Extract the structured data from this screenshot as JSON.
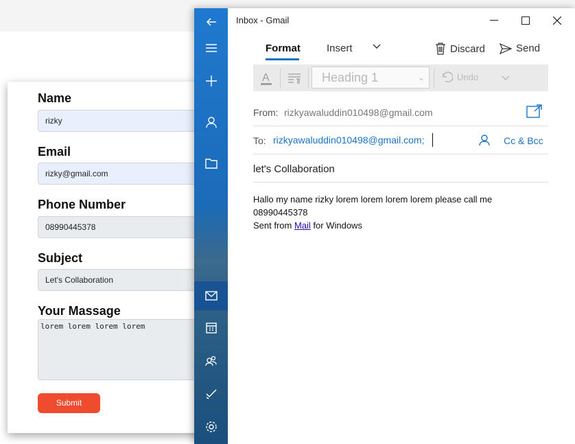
{
  "form": {
    "name_label": "Name",
    "name_value": "rizky",
    "email_label": "Email",
    "email_value": "rizky@gmail.com",
    "phone_label": "Phone Number",
    "phone_value": "08990445378",
    "subject_label": "Subject",
    "subject_value": "Let's Collaboration",
    "message_label": "Your Massage",
    "message_value": "lorem lorem lorem lorem",
    "submit_label": "Submit"
  },
  "mail": {
    "window_title": "Inbox - Gmail",
    "tabs": [
      "Format",
      "Insert"
    ],
    "discard_label": "Discard",
    "send_label": "Send",
    "heading_style": "Heading 1",
    "undo_label": "Undo",
    "from_label": "From:",
    "from_value": "rizkyawaluddin010498@gmail.com",
    "to_label": "To:",
    "to_value": "rizkyawaluddin010498@gmail.com;",
    "cc_bcc_label": "Cc & Bcc",
    "subject": "let's Collaboration",
    "body_line1": "Hallo my name rizky     lorem lorem lorem lorem please call me",
    "body_line2": "08990445378",
    "body_line3_prefix": "Sent from ",
    "body_line3_link": "Mail",
    "body_line3_suffix": " for Windows"
  },
  "icons": {
    "rail": [
      "back-arrow-icon",
      "hamburger-icon",
      "plus-icon",
      "person-icon",
      "folder-icon",
      "mail-icon",
      "calendar-icon",
      "people-icon",
      "todo-icon",
      "settings-icon"
    ]
  },
  "colors": {
    "accent": "#1a73c7",
    "submit": "#ef4b2f",
    "rail": "#2079cf"
  }
}
